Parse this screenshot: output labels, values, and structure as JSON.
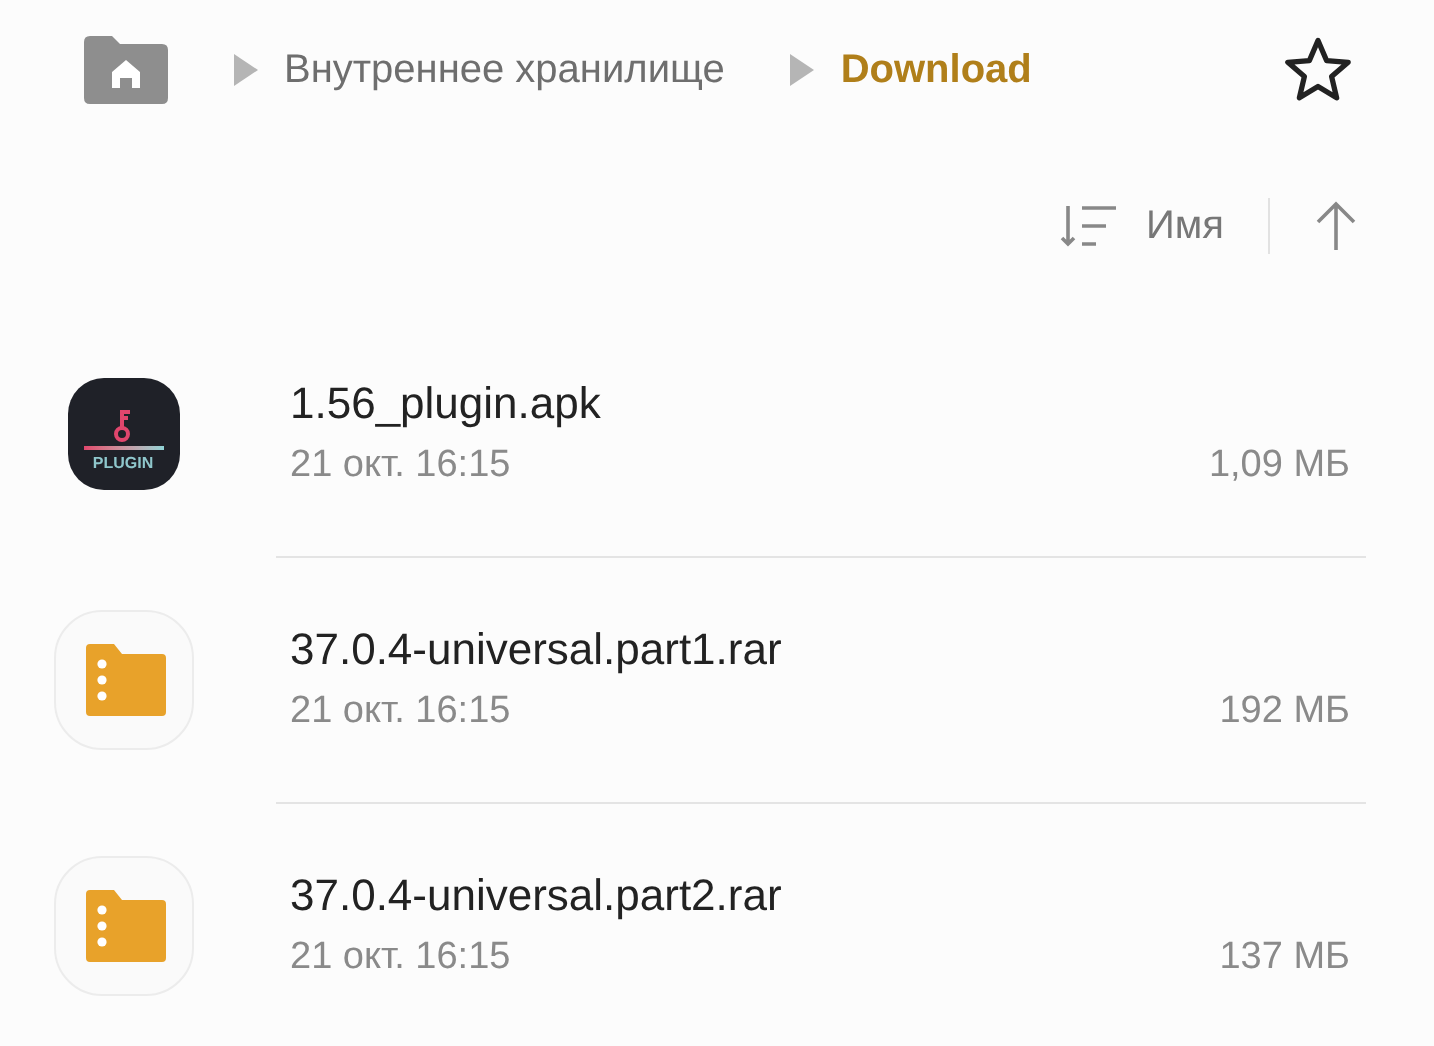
{
  "breadcrumb": [
    {
      "label": "Внутреннее хранилище",
      "current": false
    },
    {
      "label": "Download",
      "current": true
    }
  ],
  "sort": {
    "label": "Имя"
  },
  "files": [
    {
      "kind": "apk",
      "icon_text": "PLUGIN",
      "name": "1.56_plugin.apk",
      "date": "21 окт. 16:15",
      "size": "1,09 МБ"
    },
    {
      "kind": "archive",
      "name": "37.0.4-universal.part1.rar",
      "date": "21 окт. 16:15",
      "size": "192 МБ"
    },
    {
      "kind": "archive",
      "name": "37.0.4-universal.part2.rar",
      "date": "21 окт. 16:15",
      "size": "137 МБ"
    }
  ]
}
